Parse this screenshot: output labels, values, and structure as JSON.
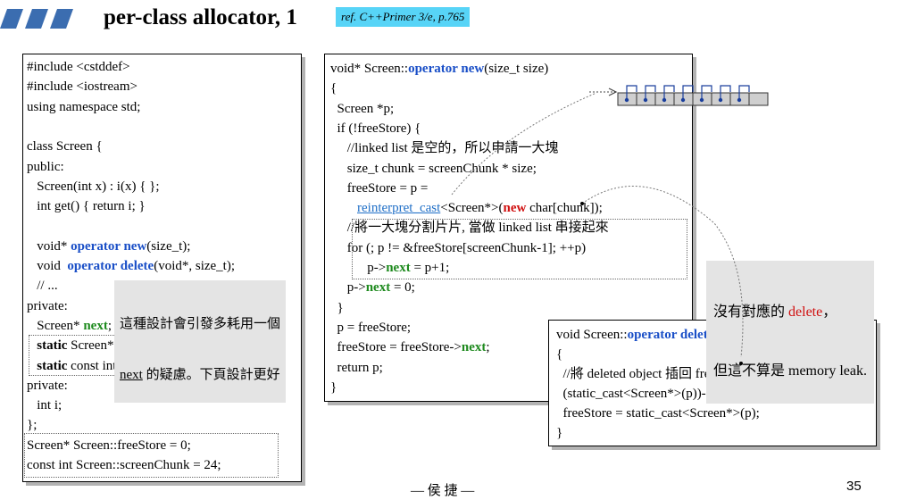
{
  "title": "per-class allocator, 1",
  "reference": "ref. C++Primer 3/e, p.765",
  "left_code": {
    "lines": [
      [
        {
          "t": "#include <cstddef>"
        }
      ],
      [
        {
          "t": "#include <iostream>"
        }
      ],
      [
        {
          "t": "using namespace std;"
        }
      ],
      [],
      [
        {
          "t": "class Screen {"
        }
      ],
      [
        {
          "t": "public:"
        }
      ],
      [
        {
          "t": "   Screen(int x) : i(x) { };"
        }
      ],
      [
        {
          "t": "   int get() { return i; }"
        }
      ],
      [],
      [
        {
          "t": "   void* "
        },
        {
          "t": "operator new",
          "c": "kw"
        },
        {
          "t": "(size_t);"
        }
      ],
      [
        {
          "t": "   void  "
        },
        {
          "t": "operator delete",
          "c": "kw"
        },
        {
          "t": "(void*, size_t);"
        }
      ],
      [
        {
          "t": "   // ..."
        }
      ],
      [
        {
          "t": "private:"
        }
      ],
      [
        {
          "t": "   Screen* "
        },
        {
          "t": "next",
          "c": "kg"
        },
        {
          "t": ";"
        }
      ],
      [
        {
          "t": "   "
        },
        {
          "t": "static",
          "c": "kb"
        },
        {
          "t": " Screen* freeStore;"
        }
      ],
      [
        {
          "t": "   "
        },
        {
          "t": "static",
          "c": "kb"
        },
        {
          "t": " const int screenChunk;"
        }
      ],
      [
        {
          "t": "private:"
        }
      ],
      [
        {
          "t": "   int i;"
        }
      ],
      [
        {
          "t": "};"
        }
      ],
      [
        {
          "t": "Screen* Screen::freeStore = 0;"
        }
      ],
      [
        {
          "t": "const int Screen::screenChunk = 24;"
        }
      ]
    ]
  },
  "mid_code": {
    "lines": [
      [
        {
          "t": "void* Screen::"
        },
        {
          "t": "operator new",
          "c": "kw"
        },
        {
          "t": "(size_t size)"
        }
      ],
      [
        {
          "t": "{"
        }
      ],
      [
        {
          "t": "  Screen *p;"
        }
      ],
      [
        {
          "t": "  if (!freeStore) {"
        }
      ],
      [
        {
          "t": "     //linked list 是空的，所以申請一大塊"
        }
      ],
      [
        {
          "t": "     size_t chunk = screenChunk * size;"
        }
      ],
      [
        {
          "t": "     freeStore = p ="
        }
      ],
      [
        {
          "t": "        "
        },
        {
          "t": "reinterpret_cast",
          "c": "ri"
        },
        {
          "t": "<Screen*>("
        },
        {
          "t": "new",
          "c": "kr"
        },
        {
          "t": " char[chunk]);"
        }
      ],
      [
        {
          "t": "     //將一大塊分割片片, 當做 linked list 串接起來"
        }
      ],
      [
        {
          "t": "     for (; p != &freeStore[screenChunk-1]; ++p)"
        }
      ],
      [
        {
          "t": "           p->"
        },
        {
          "t": "next",
          "c": "kg"
        },
        {
          "t": " = p+1;"
        }
      ],
      [
        {
          "t": "     p->"
        },
        {
          "t": "next",
          "c": "kg"
        },
        {
          "t": " = 0;"
        }
      ],
      [
        {
          "t": "  }"
        }
      ],
      [
        {
          "t": "  p = freeStore;"
        }
      ],
      [
        {
          "t": "  freeStore = freeStore->"
        },
        {
          "t": "next",
          "c": "kg"
        },
        {
          "t": ";"
        }
      ],
      [
        {
          "t": "  return p;"
        }
      ],
      [
        {
          "t": "}"
        }
      ]
    ]
  },
  "delete_code": {
    "lines": [
      [
        {
          "t": "void Screen::"
        },
        {
          "t": "operator delete",
          "c": "kw"
        },
        {
          "t": "(void *p, size_t)"
        }
      ],
      [
        {
          "t": "{"
        }
      ],
      [
        {
          "t": "  //將 deleted object 插回 free list 前端"
        }
      ],
      [
        {
          "t": "  (static_cast<Screen*>(p))->"
        },
        {
          "t": "next",
          "c": "kg"
        },
        {
          "t": " = freeStore;"
        }
      ],
      [
        {
          "t": "  freeStore = static_cast<Screen*>(p);"
        }
      ],
      [
        {
          "t": "}"
        }
      ]
    ]
  },
  "callout_left": {
    "line1": "這種設計會引發多耗用一個",
    "line2_u": "next",
    "line2_rest": " 的疑慮。下頁設計更好"
  },
  "callout_right": {
    "line1_pre": "沒有對應的 ",
    "line1_red": "delete",
    "line1_post": "，",
    "line2": "但這不算是 memory leak."
  },
  "footer": "— 侯 捷 —",
  "page_number": "35",
  "colors": {
    "keyword": "#1a4fc7",
    "next": "#1e8a1e",
    "new": "#d01010",
    "ref_bg": "#57d4f7",
    "callout_bg": "#e4e4e4"
  }
}
